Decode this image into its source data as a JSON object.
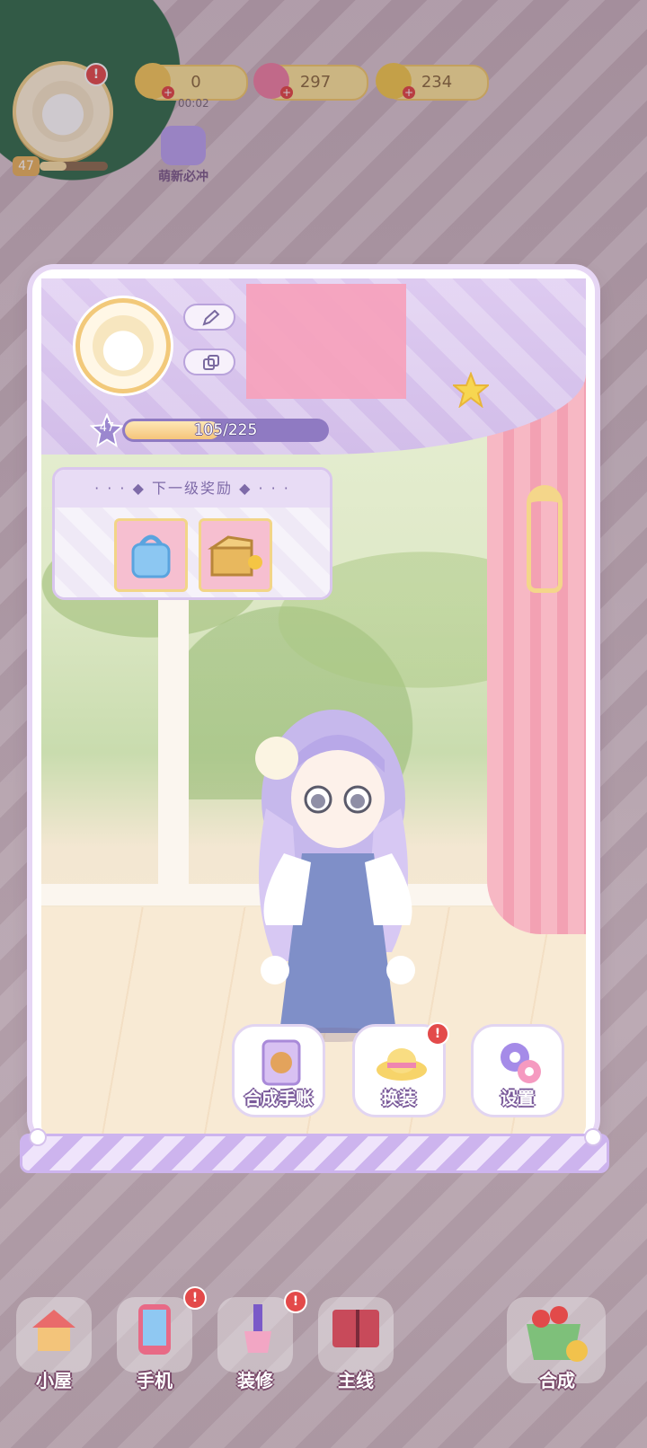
{
  "hud": {
    "energy_value": "0",
    "energy_timer": "00:02",
    "gems_value": "297",
    "coins_value": "234",
    "player_level": "47",
    "promo_label": "萌新必冲",
    "notification_mark": "!"
  },
  "profile": {
    "level": "47",
    "xp_text": "105/225",
    "xp_progress": 0.467,
    "next_reward_title": "· · · ◆ 下一级奖励 ◆ · · ·",
    "rewards": [
      "blue-bag-icon",
      "cardboard-box-icon"
    ]
  },
  "actions": [
    {
      "label": "合成手账",
      "icon": "notebook-icon"
    },
    {
      "label": "换装",
      "icon": "hat-icon"
    },
    {
      "label": "设置",
      "icon": "gear-icon"
    }
  ],
  "nav": [
    {
      "label": "小屋",
      "icon": "house-icon"
    },
    {
      "label": "手机",
      "icon": "phone-icon"
    },
    {
      "label": "装修",
      "icon": "brush-icon"
    },
    {
      "label": "主线",
      "icon": "book-icon"
    },
    {
      "label": "合成",
      "icon": "teacup-icon"
    }
  ],
  "colors": {
    "panel_accent": "#d2bde9",
    "xp_bar": "#8f7ac2",
    "alert": "#e34a4a"
  }
}
